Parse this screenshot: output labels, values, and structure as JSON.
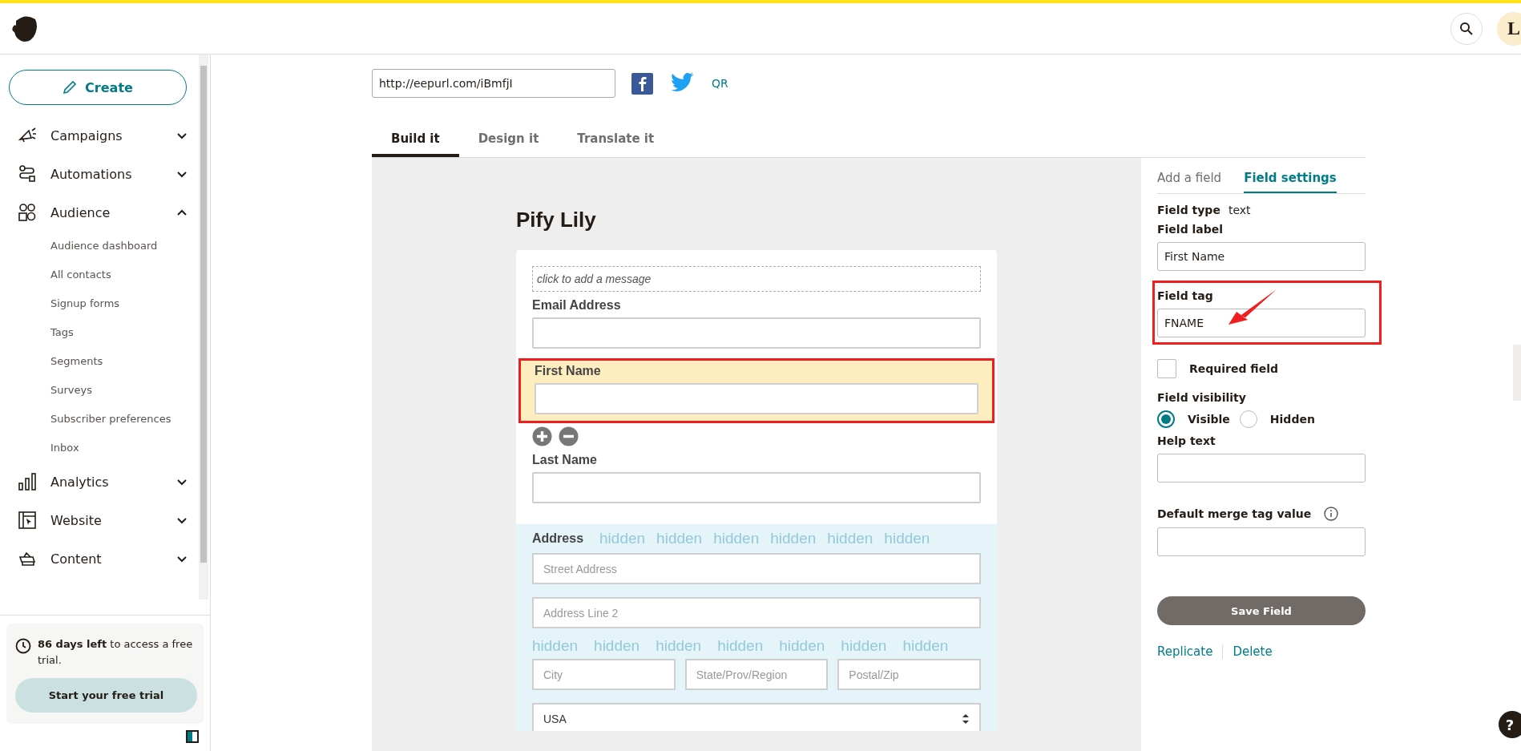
{
  "sidebar": {
    "create_button": "Create",
    "nav": [
      {
        "label": "Campaigns",
        "expanded": false
      },
      {
        "label": "Automations",
        "expanded": false
      },
      {
        "label": "Audience",
        "expanded": true,
        "children": [
          {
            "label": "Audience dashboard"
          },
          {
            "label": "All contacts"
          },
          {
            "label": "Signup forms"
          },
          {
            "label": "Tags"
          },
          {
            "label": "Segments"
          },
          {
            "label": "Surveys"
          },
          {
            "label": "Subscriber preferences"
          },
          {
            "label": "Inbox"
          }
        ]
      },
      {
        "label": "Analytics",
        "expanded": false
      },
      {
        "label": "Website",
        "expanded": false
      },
      {
        "label": "Content",
        "expanded": false
      }
    ],
    "trial": {
      "text": "**86 days left** to access a free trial.",
      "button": "Start your free trial"
    }
  },
  "header": {
    "avatar": "L"
  },
  "share": {
    "url": "http://eepurl.com/iBmfjI",
    "qr": "QR"
  },
  "tabs": [
    {
      "label": "Build it",
      "selected": true
    },
    {
      "label": "Design it",
      "selected": false
    },
    {
      "label": "Translate it",
      "selected": false
    }
  ],
  "form": {
    "title": "Pify Lily",
    "message_placeholder": "click to add a message",
    "fields": [
      {
        "label": "Email Address",
        "selected": false
      },
      {
        "label": "First Name",
        "selected": true
      },
      {
        "label": "Last Name",
        "selected": false
      }
    ],
    "address": {
      "label": "Address",
      "watermarks_row_1": [
        "hidden",
        "hidden",
        "hidden",
        "hidden",
        "hidden",
        "hidden"
      ],
      "watermarks_row_2": [
        "hidden",
        "hidden",
        "hidden",
        "hidden",
        "hidden",
        "hidden",
        "hidden"
      ],
      "street": "Street Address",
      "line2": "Address Line 2",
      "city": "City",
      "state": "State/Prov/Region",
      "zip": "Postal/Zip",
      "country": "USA"
    }
  },
  "panel": {
    "tabs": [
      {
        "label": "Add a field",
        "selected": false
      },
      {
        "label": "Field settings",
        "selected": true
      }
    ],
    "field_type_label": "Field type",
    "field_type": "text",
    "field_label_label": "Field label",
    "field_label": "First Name",
    "field_tag_label": "Field tag",
    "field_tag": "FNAME",
    "required": {
      "label": "Required field",
      "checked": false
    },
    "visibility_label": "Field visibility",
    "visibility": [
      {
        "label": "Visible",
        "selected": true
      },
      {
        "label": "Hidden",
        "selected": false
      }
    ],
    "help_label": "Help text",
    "default_label": "Default merge tag value",
    "save": "Save Field",
    "links": [
      "Replicate",
      "Delete"
    ]
  },
  "help_button": "?"
}
